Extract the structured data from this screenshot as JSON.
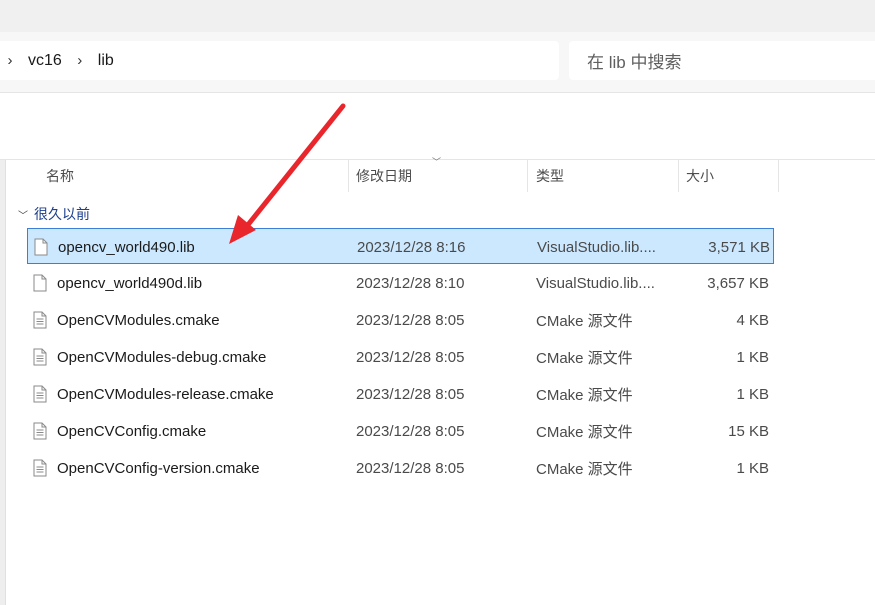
{
  "address": {
    "crumbs": [
      "vc16",
      "lib"
    ]
  },
  "search": {
    "placeholder": "在 lib 中搜索"
  },
  "columns": {
    "name": "名称",
    "date": "修改日期",
    "type": "类型",
    "size": "大小"
  },
  "group": {
    "label": "很久以前"
  },
  "files": [
    {
      "name": "opencv_world490.lib",
      "date": "2023/12/28 8:16",
      "type": "VisualStudio.lib....",
      "size": "3,571 KB",
      "icon": "blank-file-icon",
      "selected": true
    },
    {
      "name": "opencv_world490d.lib",
      "date": "2023/12/28 8:10",
      "type": "VisualStudio.lib....",
      "size": "3,657 KB",
      "icon": "blank-file-icon",
      "selected": false
    },
    {
      "name": "OpenCVModules.cmake",
      "date": "2023/12/28 8:05",
      "type": "CMake 源文件",
      "size": "4 KB",
      "icon": "text-file-icon",
      "selected": false
    },
    {
      "name": "OpenCVModules-debug.cmake",
      "date": "2023/12/28 8:05",
      "type": "CMake 源文件",
      "size": "1 KB",
      "icon": "text-file-icon",
      "selected": false
    },
    {
      "name": "OpenCVModules-release.cmake",
      "date": "2023/12/28 8:05",
      "type": "CMake 源文件",
      "size": "1 KB",
      "icon": "text-file-icon",
      "selected": false
    },
    {
      "name": "OpenCVConfig.cmake",
      "date": "2023/12/28 8:05",
      "type": "CMake 源文件",
      "size": "15 KB",
      "icon": "text-file-icon",
      "selected": false
    },
    {
      "name": "OpenCVConfig-version.cmake",
      "date": "2023/12/28 8:05",
      "type": "CMake 源文件",
      "size": "1 KB",
      "icon": "text-file-icon",
      "selected": false
    }
  ],
  "colors": {
    "selection_bg": "#cce8ff",
    "selection_border": "#3d7fd6",
    "annotation_arrow": "#e8262b"
  }
}
